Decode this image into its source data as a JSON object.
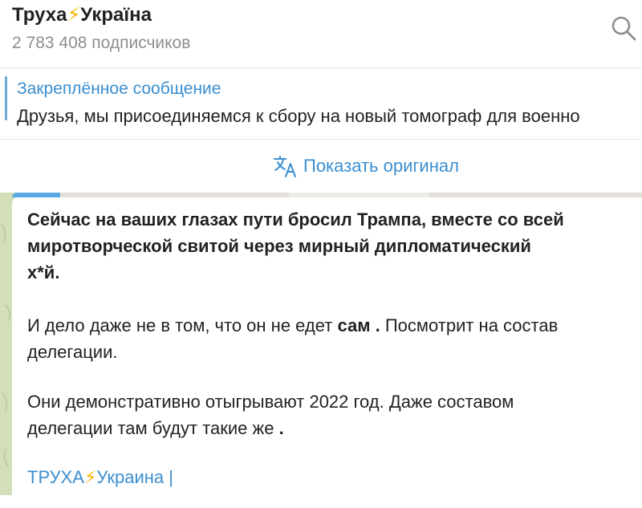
{
  "channel": {
    "title": "Труха",
    "title_emoji": "⚡",
    "title_suffix": "Україна",
    "subscribers": "2 783 408 подписчиков"
  },
  "pinned": {
    "title": "Закреплённое сообщение",
    "text": "Друзья, мы присоединяемся к сбору на новый томограф для военно"
  },
  "translate": {
    "label": "Показать оригинал"
  },
  "message": {
    "line1": "Сейчас на ваших глазах пути бросил Трампа, вместе со всей",
    "line2": "миротворческой свитой через мирный дипломатический",
    "line3": "х*й.",
    "p2_line1_a": " И дело даже не в том, что он не едет ",
    "p2_line1_bold": "сам .",
    "p2_line1_b": " Посмотрит на состав",
    "p2_line2": "делегации.",
    "p3_line1": "Они демонстративно отыгрывают 2022 год. Даже составом",
    "p3_line2": "делегации там будут такие же ",
    "p3_line2_bold": ".",
    "link_a": "ТРУХА",
    "link_emoji": "⚡",
    "link_b": "Украина |"
  },
  "colors": {
    "accent": "#3a8ed0",
    "emoji_bolt": "#f5b400",
    "chat_background": "#d3dfb8"
  },
  "icons": {
    "search": "search-icon",
    "translate": "translate-icon"
  }
}
